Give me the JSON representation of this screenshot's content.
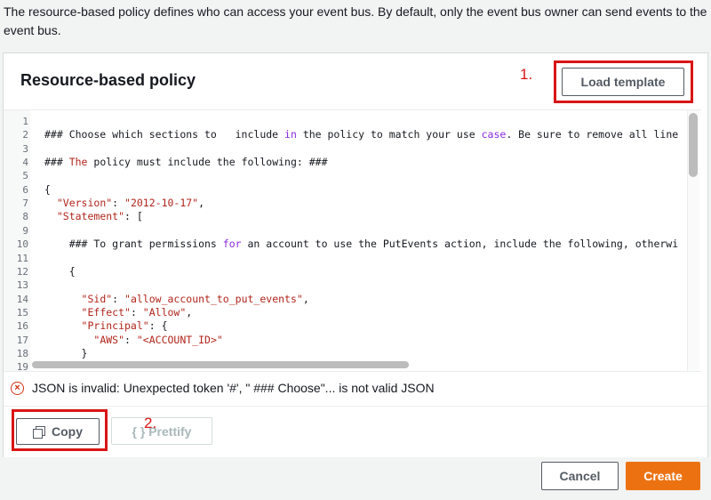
{
  "intro_text": "The resource-based policy defines who can access your event bus. By default, only the event bus owner can send events to the event bus.",
  "panel": {
    "title": "Resource-based policy",
    "load_template_label": "Load template"
  },
  "annotations": {
    "step1": "1.",
    "step2": "2."
  },
  "editor": {
    "lines": [
      {
        "n": "1",
        "parts": []
      },
      {
        "n": "2",
        "parts": [
          [
            "### Choose which sections to   include ",
            ""
          ],
          [
            "in",
            "kw"
          ],
          [
            " the policy to match your use ",
            ""
          ],
          [
            "case",
            "kw"
          ],
          [
            ". Be sure to remove all line",
            ""
          ]
        ]
      },
      {
        "n": "3",
        "parts": []
      },
      {
        "n": "4",
        "parts": [
          [
            "### ",
            ""
          ],
          [
            "The",
            "str"
          ],
          [
            " policy must include the following: ###",
            ""
          ]
        ]
      },
      {
        "n": "5",
        "parts": []
      },
      {
        "n": "6",
        "parts": [
          [
            "{",
            ""
          ]
        ]
      },
      {
        "n": "7",
        "parts": [
          [
            "  ",
            ""
          ],
          [
            "\"Version\"",
            "str"
          ],
          [
            ": ",
            ""
          ],
          [
            "\"2012-10-17\"",
            "str"
          ],
          [
            ",",
            ""
          ]
        ]
      },
      {
        "n": "8",
        "parts": [
          [
            "  ",
            ""
          ],
          [
            "\"Statement\"",
            "str"
          ],
          [
            ": [",
            ""
          ]
        ]
      },
      {
        "n": "9",
        "parts": []
      },
      {
        "n": "10",
        "parts": [
          [
            "    ### To grant permissions ",
            ""
          ],
          [
            "for",
            "kw"
          ],
          [
            " an account to use the PutEvents action, include the following, otherwi",
            ""
          ]
        ]
      },
      {
        "n": "11",
        "parts": []
      },
      {
        "n": "12",
        "parts": [
          [
            "    {",
            ""
          ]
        ]
      },
      {
        "n": "13",
        "parts": []
      },
      {
        "n": "14",
        "parts": [
          [
            "      ",
            ""
          ],
          [
            "\"Sid\"",
            "str"
          ],
          [
            ": ",
            ""
          ],
          [
            "\"allow_account_to_put_events\"",
            "str"
          ],
          [
            ",",
            ""
          ]
        ]
      },
      {
        "n": "15",
        "parts": [
          [
            "      ",
            ""
          ],
          [
            "\"Effect\"",
            "str"
          ],
          [
            ": ",
            ""
          ],
          [
            "\"Allow\"",
            "str"
          ],
          [
            ",",
            ""
          ]
        ]
      },
      {
        "n": "16",
        "parts": [
          [
            "      ",
            ""
          ],
          [
            "\"Principal\"",
            "str"
          ],
          [
            ": {",
            ""
          ]
        ]
      },
      {
        "n": "17",
        "parts": [
          [
            "        ",
            ""
          ],
          [
            "\"AWS\"",
            "str"
          ],
          [
            ": ",
            ""
          ],
          [
            "\"<ACCOUNT_ID>\"",
            "str"
          ]
        ]
      },
      {
        "n": "18",
        "parts": [
          [
            "      }",
            ""
          ]
        ]
      },
      {
        "n": "19",
        "parts": []
      }
    ]
  },
  "error": {
    "icon": "error-x-icon",
    "message": "JSON is invalid: Unexpected token '#', \" ### Choose\"... is not valid JSON"
  },
  "footer": {
    "copy_label": "Copy",
    "prettify_label": "{ } Prettify"
  },
  "actions": {
    "cancel_label": "Cancel",
    "create_label": "Create"
  },
  "colors": {
    "primary": "#ec7211",
    "annotation_red": "#d91515",
    "error_red": "#d13212"
  }
}
